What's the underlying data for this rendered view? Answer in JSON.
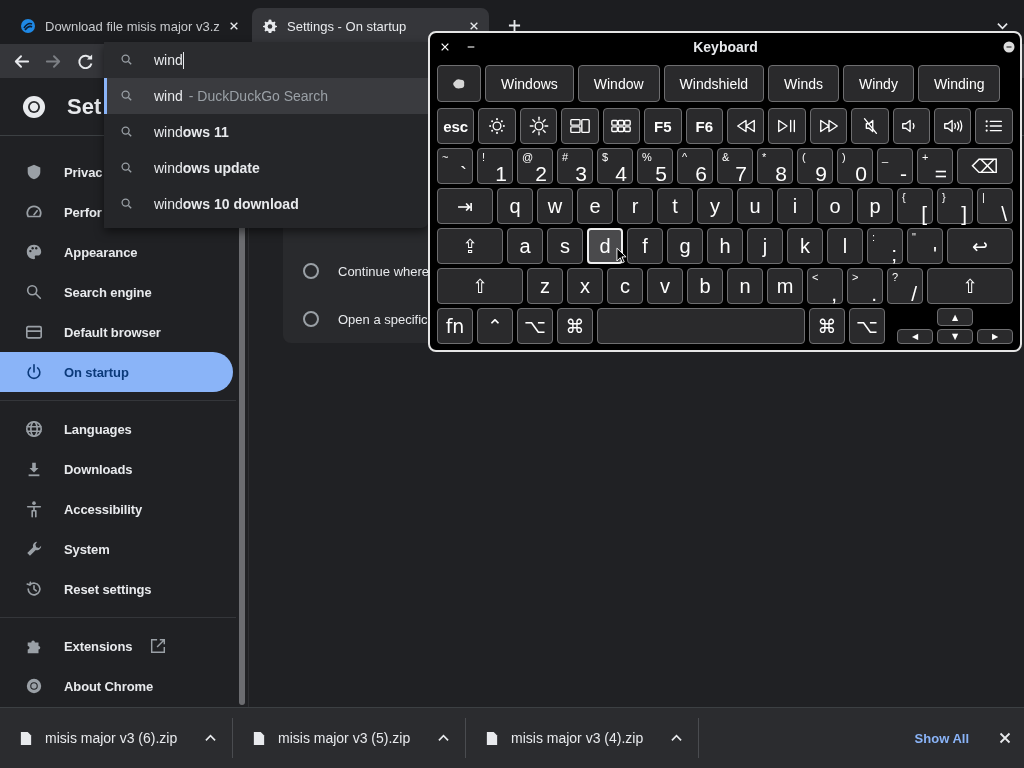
{
  "tabs": [
    {
      "title": "Download file misis major v3.z",
      "selected": false
    },
    {
      "title": "Settings - On startup",
      "selected": true
    }
  ],
  "toolbar": {
    "nav": [
      {
        "disabled": false
      },
      {
        "disabled": true
      },
      {
        "disabled": false
      }
    ]
  },
  "omnibox": {
    "value": "wind",
    "suggestions": [
      {
        "text": "wind",
        "source": "- DuckDuckGo Search",
        "selected": true
      },
      {
        "text": "wind**ows 11**",
        "selected": false
      },
      {
        "text": "wind**ows update**",
        "selected": false
      },
      {
        "text": "wind**ows 10 download**",
        "selected": false
      }
    ]
  },
  "settings_header": {
    "title": "Set"
  },
  "sidebar": {
    "groups": [
      {
        "items": [
          {
            "label": "Privac",
            "selected": false
          },
          {
            "label": "Perfor",
            "selected": false
          },
          {
            "label": "Appearance",
            "selected": false
          },
          {
            "label": "Search engine",
            "selected": false
          },
          {
            "label": "Default browser",
            "selected": false
          },
          {
            "label": "On startup",
            "selected": true
          }
        ]
      },
      {
        "items": [
          {
            "label": "Languages",
            "selected": false
          },
          {
            "label": "Downloads",
            "selected": false
          },
          {
            "label": "Accessibility",
            "selected": false
          },
          {
            "label": "System",
            "selected": false
          },
          {
            "label": "Reset settings",
            "selected": false
          }
        ]
      },
      {
        "items": [
          {
            "label": "Extensions",
            "selected": false,
            "external": true
          },
          {
            "label": "About Chrome",
            "selected": false,
            "external": false
          }
        ]
      }
    ]
  },
  "startup_options": [
    {
      "label": "Continue where",
      "checked": false
    },
    {
      "label": "Open a specific",
      "checked": false
    }
  ],
  "keyboard": {
    "title": "Keyboard",
    "suggestions": [
      "Windows",
      "Window",
      "Windshield",
      "Winds",
      "Windy",
      "Winding"
    ],
    "function_row": [
      {
        "kind": "text",
        "label": "esc"
      },
      {
        "kind": "icon"
      },
      {
        "kind": "icon"
      },
      {
        "kind": "icon"
      },
      {
        "kind": "icon"
      },
      {
        "kind": "text",
        "label": "F5"
      },
      {
        "kind": "text",
        "label": "F6"
      },
      {
        "kind": "icon"
      },
      {
        "kind": "icon"
      },
      {
        "kind": "icon"
      },
      {
        "kind": "icon"
      },
      {
        "kind": "icon"
      },
      {
        "kind": "icon"
      },
      {
        "kind": "icon"
      }
    ],
    "number_row": [
      {
        "kind": "dual",
        "shift": "~",
        "label": "`"
      },
      {
        "kind": "dual",
        "shift": "!",
        "label": "1"
      },
      {
        "kind": "dual",
        "shift": "@",
        "label": "2"
      },
      {
        "kind": "dual",
        "shift": "#",
        "label": "3"
      },
      {
        "kind": "dual",
        "shift": "$",
        "label": "4"
      },
      {
        "kind": "dual",
        "shift": "%",
        "label": "5"
      },
      {
        "kind": "dual",
        "shift": "^",
        "label": "6"
      },
      {
        "kind": "dual",
        "shift": "&",
        "label": "7"
      },
      {
        "kind": "dual",
        "shift": "*",
        "label": "8"
      },
      {
        "kind": "dual",
        "shift": "(",
        "label": "9"
      },
      {
        "kind": "dual",
        "shift": ")",
        "label": "0"
      },
      {
        "kind": "dual",
        "shift": "_",
        "label": "-"
      },
      {
        "kind": "dual",
        "shift": "+",
        "label": "="
      },
      {
        "kind": "mod",
        "label": "⌫"
      }
    ],
    "tab_row": [
      {
        "kind": "mod",
        "label": "⇥"
      },
      {
        "kind": "char",
        "label": "q"
      },
      {
        "kind": "char",
        "label": "w"
      },
      {
        "kind": "char",
        "label": "e"
      },
      {
        "kind": "char",
        "label": "r"
      },
      {
        "kind": "char",
        "label": "t"
      },
      {
        "kind": "char",
        "label": "y"
      },
      {
        "kind": "char",
        "label": "u"
      },
      {
        "kind": "char",
        "label": "i"
      },
      {
        "kind": "char",
        "label": "o"
      },
      {
        "kind": "char",
        "label": "p"
      },
      {
        "kind": "dual",
        "shift": "{",
        "label": "["
      },
      {
        "kind": "dual",
        "shift": "}",
        "label": "]"
      },
      {
        "kind": "dual",
        "shift": "|",
        "label": "\\"
      }
    ],
    "caps_row": [
      {
        "kind": "mod",
        "label": "⇪",
        "pressed": false
      },
      {
        "kind": "char",
        "label": "a",
        "pressed": false
      },
      {
        "kind": "char",
        "label": "s",
        "pressed": false
      },
      {
        "kind": "char",
        "label": "d",
        "pressed": true
      },
      {
        "kind": "char",
        "label": "f",
        "pressed": false
      },
      {
        "kind": "char",
        "label": "g",
        "pressed": false
      },
      {
        "kind": "char",
        "label": "h",
        "pressed": false
      },
      {
        "kind": "char",
        "label": "j",
        "pressed": false
      },
      {
        "kind": "char",
        "label": "k",
        "pressed": false
      },
      {
        "kind": "char",
        "label": "l",
        "pressed": false
      },
      {
        "kind": "dual",
        "shift": ":",
        "label": ";",
        "pressed": false
      },
      {
        "kind": "dual",
        "shift": "\"",
        "label": "'",
        "pressed": false
      },
      {
        "kind": "mod",
        "label": "↩",
        "pressed": false
      }
    ],
    "shift_row": [
      {
        "kind": "mod",
        "label": "⇧"
      },
      {
        "kind": "char",
        "label": "z"
      },
      {
        "kind": "char",
        "label": "x"
      },
      {
        "kind": "char",
        "label": "c"
      },
      {
        "kind": "char",
        "label": "v"
      },
      {
        "kind": "char",
        "label": "b"
      },
      {
        "kind": "char",
        "label": "n"
      },
      {
        "kind": "char",
        "label": "m"
      },
      {
        "kind": "dual",
        "shift": "<",
        "label": ","
      },
      {
        "kind": "dual",
        "shift": ">",
        "label": "."
      },
      {
        "kind": "dual",
        "shift": "?",
        "label": "/"
      },
      {
        "kind": "mod",
        "label": "⇧"
      }
    ],
    "bottom_row": [
      {
        "kind": "char",
        "label": "fn"
      },
      {
        "kind": "char",
        "label": "⌃"
      },
      {
        "kind": "char",
        "label": "⌥"
      },
      {
        "kind": "char",
        "label": "⌘"
      },
      {
        "kind": "space"
      },
      {
        "kind": "char",
        "label": "⌘"
      },
      {
        "kind": "char",
        "label": "⌥"
      },
      {
        "kind": "arrows",
        "keys": [
          "▲",
          "◀",
          "▼",
          "▶"
        ]
      }
    ]
  },
  "downloads": {
    "files": [
      "misis major v3 (6).zip",
      "misis major v3 (5).zip",
      "misis major v3 (4).zip"
    ],
    "show_all": "Show All"
  }
}
